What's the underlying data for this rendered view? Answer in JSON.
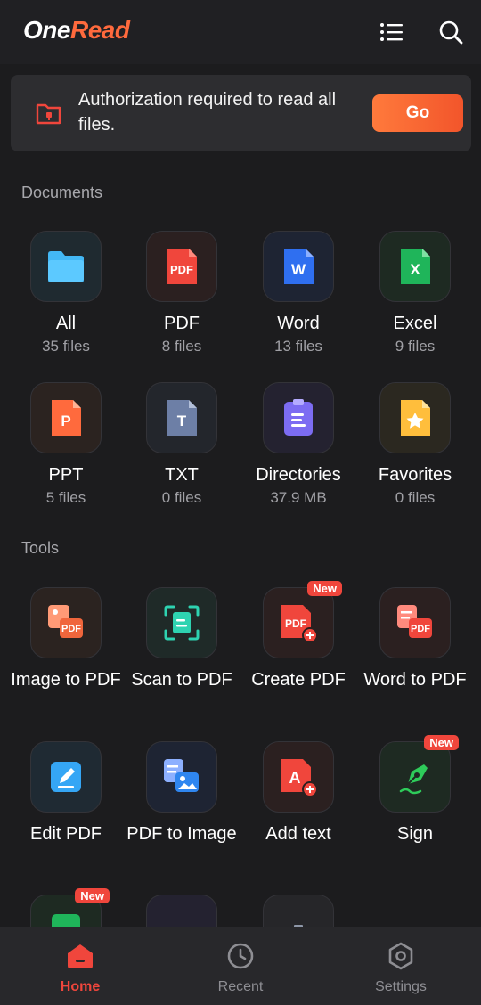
{
  "header": {
    "logo_one": "One",
    "logo_read": "Read"
  },
  "banner": {
    "message": "Authorization required to read all files.",
    "go_label": "Go"
  },
  "documents": {
    "title": "Documents",
    "items": [
      {
        "label": "All",
        "sub": "35 files",
        "icon": "folder-icon"
      },
      {
        "label": "PDF",
        "sub": "8 files",
        "icon": "pdf-icon"
      },
      {
        "label": "Word",
        "sub": "13 files",
        "icon": "word-icon"
      },
      {
        "label": "Excel",
        "sub": "9 files",
        "icon": "excel-icon"
      },
      {
        "label": "PPT",
        "sub": "5 files",
        "icon": "ppt-icon"
      },
      {
        "label": "TXT",
        "sub": "0 files",
        "icon": "txt-icon"
      },
      {
        "label": "Directories",
        "sub": "37.9 MB",
        "icon": "directories-icon"
      },
      {
        "label": "Favorites",
        "sub": "0 files",
        "icon": "favorites-icon"
      }
    ]
  },
  "tools": {
    "title": "Tools",
    "items": [
      {
        "label": "Image to PDF",
        "icon": "image-to-pdf-icon"
      },
      {
        "label": "Scan to PDF",
        "icon": "scan-to-pdf-icon"
      },
      {
        "label": "Create PDF",
        "icon": "create-pdf-icon",
        "badge": "New"
      },
      {
        "label": "Word to PDF",
        "icon": "word-to-pdf-icon"
      },
      {
        "label": "Edit PDF",
        "icon": "edit-pdf-icon"
      },
      {
        "label": "PDF to Image",
        "icon": "pdf-to-image-icon"
      },
      {
        "label": "Add text",
        "icon": "add-text-icon"
      },
      {
        "label": "Sign",
        "icon": "sign-icon",
        "badge": "New"
      }
    ],
    "partial_badge": "New"
  },
  "tabs": [
    {
      "label": "Home",
      "icon": "home-icon",
      "active": true
    },
    {
      "label": "Recent",
      "icon": "clock-icon"
    },
    {
      "label": "Settings",
      "icon": "settings-icon"
    }
  ],
  "colors": {
    "accent": "#f0463c",
    "brand_orange": "#ff6a3d",
    "background": "#1c1c1e"
  }
}
